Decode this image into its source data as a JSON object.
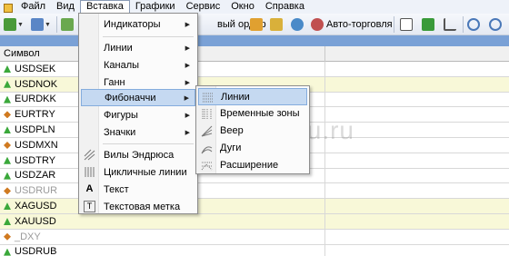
{
  "menubar": {
    "items": [
      "Файл",
      "Вид",
      "Вставка",
      "Графики",
      "Сервис",
      "Окно",
      "Справка"
    ],
    "active_index": 2
  },
  "toolbar": {
    "new_order_label": "вый ордер",
    "autotrading_label": "Авто-торговля"
  },
  "grid": {
    "symbol_header": "Символ",
    "rows": [
      {
        "symbol": "USDSEK",
        "dir": "up",
        "highlight": false,
        "dim": false
      },
      {
        "symbol": "USDNOK",
        "dir": "up",
        "highlight": true,
        "dim": false
      },
      {
        "symbol": "EURDKK",
        "dir": "up",
        "highlight": false,
        "dim": false
      },
      {
        "symbol": "EURTRY",
        "dir": "neutral",
        "highlight": false,
        "dim": false
      },
      {
        "symbol": "USDPLN",
        "dir": "up",
        "highlight": false,
        "dim": false
      },
      {
        "symbol": "USDMXN",
        "dir": "neutral",
        "highlight": false,
        "dim": false
      },
      {
        "symbol": "USDTRY",
        "dir": "up",
        "highlight": false,
        "dim": false
      },
      {
        "symbol": "USDZAR",
        "dir": "up",
        "highlight": false,
        "dim": false
      },
      {
        "symbol": "USDRUR",
        "dir": "neutral",
        "highlight": false,
        "dim": true
      },
      {
        "symbol": "XAGUSD",
        "dir": "up",
        "highlight": true,
        "dim": false
      },
      {
        "symbol": "XAUUSD",
        "dir": "up",
        "highlight": true,
        "dim": false
      },
      {
        "symbol": "_DXY",
        "dir": "neutral",
        "highlight": false,
        "dim": true
      },
      {
        "symbol": "USDRUB",
        "dir": "up",
        "highlight": false,
        "dim": false
      }
    ]
  },
  "insert_menu": {
    "indicators": "Индикаторы",
    "lines": "Линии",
    "channels": "Каналы",
    "gann": "Ганн",
    "fibonacci": "Фибоначчи",
    "shapes": "Фигуры",
    "arrows": "Значки",
    "andrews_pitchfork": "Вилы Эндрюса",
    "cycle_lines": "Цикличные линии",
    "text": "Текст",
    "text_label": "Текстовая метка"
  },
  "fibonacci_submenu": {
    "lines": "Линии",
    "time_zones": "Временные зоны",
    "fan": "Веер",
    "arcs": "Дуги",
    "expansion": "Расширение"
  },
  "watermark": "strategy4you.ru",
  "colors": {
    "menu_highlight": "#c5d9f1",
    "band": "#7aa1d6",
    "row_highlight": "#f8f8d8",
    "up": "#3aa83a",
    "down": "#d04020"
  }
}
